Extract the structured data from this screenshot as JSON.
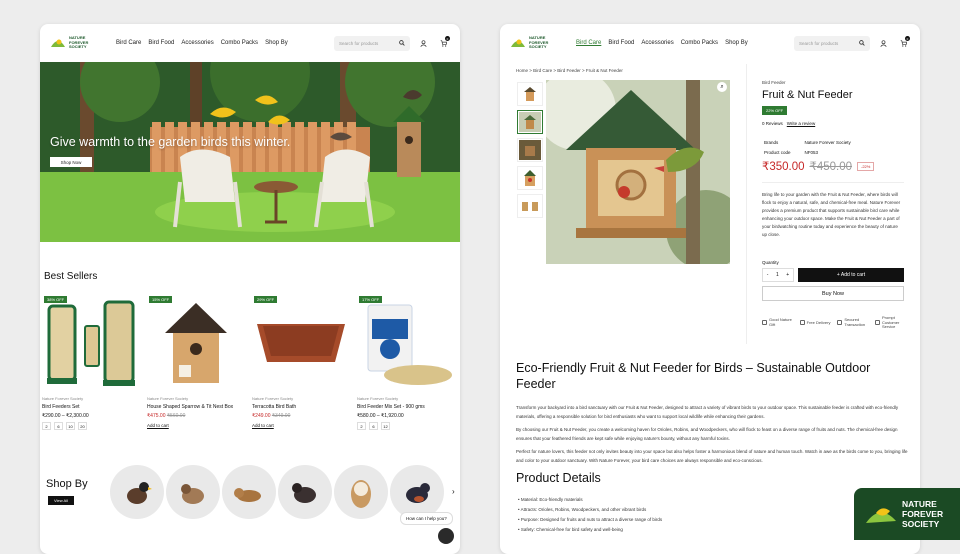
{
  "brand": {
    "name_lines": [
      "NATURE",
      "FOREVER",
      "SOCIETY"
    ],
    "tagline": "Connecting nature to the Future"
  },
  "nav": [
    "Bird Care",
    "Bird Food",
    "Accessories",
    "Combo Packs",
    "Shop By"
  ],
  "search_placeholder": "Search for products",
  "cart_count": "0",
  "hero": {
    "headline": "Give warmth to the garden birds this winter.",
    "cta": "Shop Now"
  },
  "best_sellers": {
    "title": "Best Sellers",
    "products": [
      {
        "badge": "38% OFF",
        "brand": "Nature Forever Society",
        "name": "Bird Feeders Set",
        "old_price": "",
        "price": "₹290.00 – ₹2,300.00",
        "options": [
          "2",
          "6",
          "10",
          "20"
        ],
        "action": ""
      },
      {
        "badge": "15% OFF",
        "brand": "Nature Forever Society",
        "name": "House Shaped Sparrow & Tit Nest Box",
        "old_price": "₹560.00",
        "price": "₹475.00",
        "options": [],
        "action": "Add to cart"
      },
      {
        "badge": "29% OFF",
        "brand": "Nature Forever Society",
        "name": "Terracotta Bird Bath",
        "old_price": "₹349.00",
        "price": "₹249.00",
        "options": [],
        "action": "Add to cart"
      },
      {
        "badge": "17% OFF",
        "brand": "Nature Forever Society",
        "name": "Bird Feeder Mix Set - 900 gms",
        "old_price": "",
        "price": "₹580.00 – ₹1,920.00",
        "options": [
          "2",
          "6",
          "12"
        ],
        "action": ""
      }
    ]
  },
  "shop_by": {
    "title": "Shop By",
    "view_all": "View All",
    "birds": [
      "myna",
      "sparrow",
      "chipmunk",
      "bulbul",
      "owl",
      "robin"
    ]
  },
  "help_text": "How can I help you?",
  "product_page": {
    "breadcrumb": "Home  >  Bird Care  >  Bird Feeder  >  Fruit & Nut Feeder",
    "category": "Bird Feeder",
    "title": "Fruit & Nut Feeder",
    "discount_badge": "22% OFF",
    "reviews": "0 Reviews",
    "write_review": "Write a review",
    "meta": [
      {
        "label": "Brands",
        "value": "Nature Forever Society"
      },
      {
        "label": "Product code",
        "value": "NF053"
      }
    ],
    "price": "₹350.00",
    "old_price": "₹450.00",
    "discount": "-22%",
    "description": "Bring life to your garden with the Fruit & Nut Feeder, where birds will flock to enjoy a natural, safe, and chemical-free meal. Nature Forever provides a premium product that supports sustainable bird care while enhancing your outdoor space. Make the Fruit & Nut Feeder a part of your birdwatching routine today and experience the beauty of nature up close.",
    "quantity_label": "Quantity",
    "quantity": "1",
    "add_to_cart": "+ Add to cart",
    "buy_now": "Buy Now",
    "features": [
      "Good Nature Gift",
      "Free Delivery",
      "Secured Transaction",
      "Prompt Customer Service"
    ],
    "long_title": "Eco-Friendly Fruit & Nut Feeder for Birds – Sustainable Outdoor Feeder",
    "paragraphs": [
      "Transform your backyard into a bird sanctuary with our Fruit & Nut Feeder, designed to attract a variety of vibrant birds to your outdoor space. This sustainable feeder is crafted with eco-friendly materials, offering a responsible solution for bird enthusiasts who want to support local wildlife while enhancing their gardens.",
      "By choosing our Fruit & Nut Feeder, you create a welcoming haven for Orioles, Robins, and Woodpeckers, who will flock to feast on a diverse range of fruits and nuts. The chemical-free design ensures that your feathered friends are kept safe while enjoying nature's bounty, without any harmful toxins.",
      "Perfect for nature lovers, this feeder not only invites beauty into your space but also helps foster a harmonious blend of nature and human touch. Watch in awe as the birds come to you, bringing life and color to your outdoor sanctuary. With Nature Forever, your bird care choices are always responsible and eco-conscious."
    ],
    "details_title": "Product Details",
    "details": [
      "Material: Eco-friendly materials",
      "Attracts: Orioles, Robins, Woodpeckers, and other vibrant birds",
      "Purpose: Designed for fruits and nuts to attract a diverse range of birds",
      "Safety: Chemical-free for bird safety and well-being"
    ]
  },
  "corner_logo": [
    "NATURE",
    "FOREVER",
    "SOCIETY"
  ],
  "colors": {
    "brand_green": "#2f7b32",
    "sale_red": "#c62828",
    "dark_green": "#1b4a24"
  }
}
